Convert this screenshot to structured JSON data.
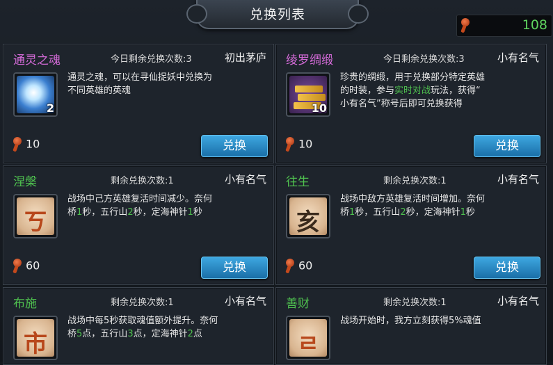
{
  "header": {
    "title": "兑换列表",
    "currency_value": "108",
    "currency_icon": "key-token-icon"
  },
  "cards": [
    {
      "name": "通灵之魂",
      "name_color": "#d26ad6",
      "remain": "今日剩余兑换次数:3",
      "rank": "初出茅庐",
      "icon": "soul-orb-icon",
      "count": "2",
      "desc": [
        "通灵之魂，可以在寻仙捉妖中兑换为",
        "不同英雄的英魂"
      ],
      "cost": "10",
      "button": "兑换"
    },
    {
      "name": "绫罗绸缎",
      "name_color": "#d26ad6",
      "remain": "今日剩余兑换次数:3",
      "rank": "小有名气",
      "icon": "silk-bundle-icon",
      "count": "10",
      "desc": [
        "珍贵的绸缎，用于兑换部分特定英雄",
        "的时装，参与实时对战玩法，获得“",
        "小有名气”称号后即可兑换获得"
      ],
      "desc_highlight": "实时对战",
      "cost": "10",
      "button": "兑换"
    },
    {
      "name": "涅槃",
      "name_color": "#4fc14f",
      "remain": "剩余兑换次数:1",
      "rank": "小有名气",
      "icon": "nirvana-glyph-icon",
      "desc": "战场中己方英雄复活时间减少。奈何桥1秒，五行山2秒，定海神针1秒",
      "cost": "60",
      "button": "兑换"
    },
    {
      "name": "往生",
      "name_color": "#4fc14f",
      "remain": "剩余兑换次数:1",
      "rank": "小有名气",
      "icon": "rebirth-glyph-icon",
      "desc": "战场中敌方英雄复活时间增加。奈何桥1秒，五行山2秒，定海神针1秒",
      "cost": "60",
      "button": "兑换"
    },
    {
      "name": "布施",
      "name_color": "#4fc14f",
      "remain": "剩余兑换次数:1",
      "rank": "小有名气",
      "icon": "alms-glyph-icon",
      "desc": "战场中每5秒获取魂值额外提升。奈何桥5点，五行山3点，定海神针2点"
    },
    {
      "name": "善财",
      "name_color": "#4fc14f",
      "remain": "剩余兑换次数:1",
      "rank": "小有名气",
      "icon": "wealth-glyph-icon",
      "desc": "战场开始时，我方立刻获得5%魂值"
    }
  ]
}
